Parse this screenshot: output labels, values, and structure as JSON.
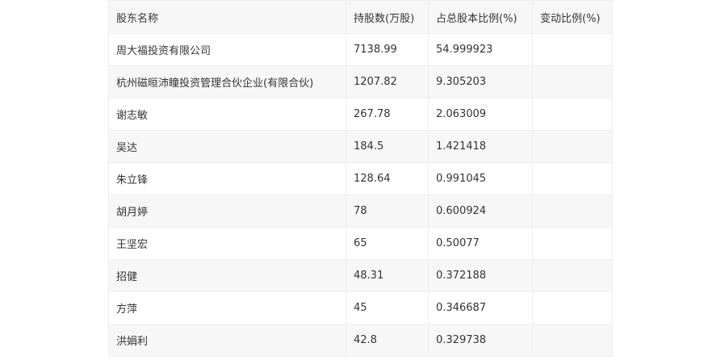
{
  "table": {
    "headers": [
      "股东名称",
      "持股数(万股)",
      "占总股本比例(%)",
      "变动比例(%)"
    ],
    "rows": [
      [
        "周大福投资有限公司",
        "7138.99",
        "54.999923",
        ""
      ],
      [
        "杭州磁晅沛瞳投资管理合伙企业(有限合伙)",
        "1207.82",
        "9.305203",
        ""
      ],
      [
        "谢志敏",
        "267.78",
        "2.063009",
        ""
      ],
      [
        "吴达",
        "184.5",
        "1.421418",
        ""
      ],
      [
        "朱立锋",
        "128.64",
        "0.991045",
        ""
      ],
      [
        "胡月婷",
        "78",
        "0.600924",
        ""
      ],
      [
        "王坚宏",
        "65",
        "0.50077",
        ""
      ],
      [
        "招健",
        "48.31",
        "0.372188",
        ""
      ],
      [
        "方萍",
        "45",
        "0.346687",
        ""
      ],
      [
        "洪娟利",
        "42.8",
        "0.329738",
        ""
      ]
    ]
  }
}
